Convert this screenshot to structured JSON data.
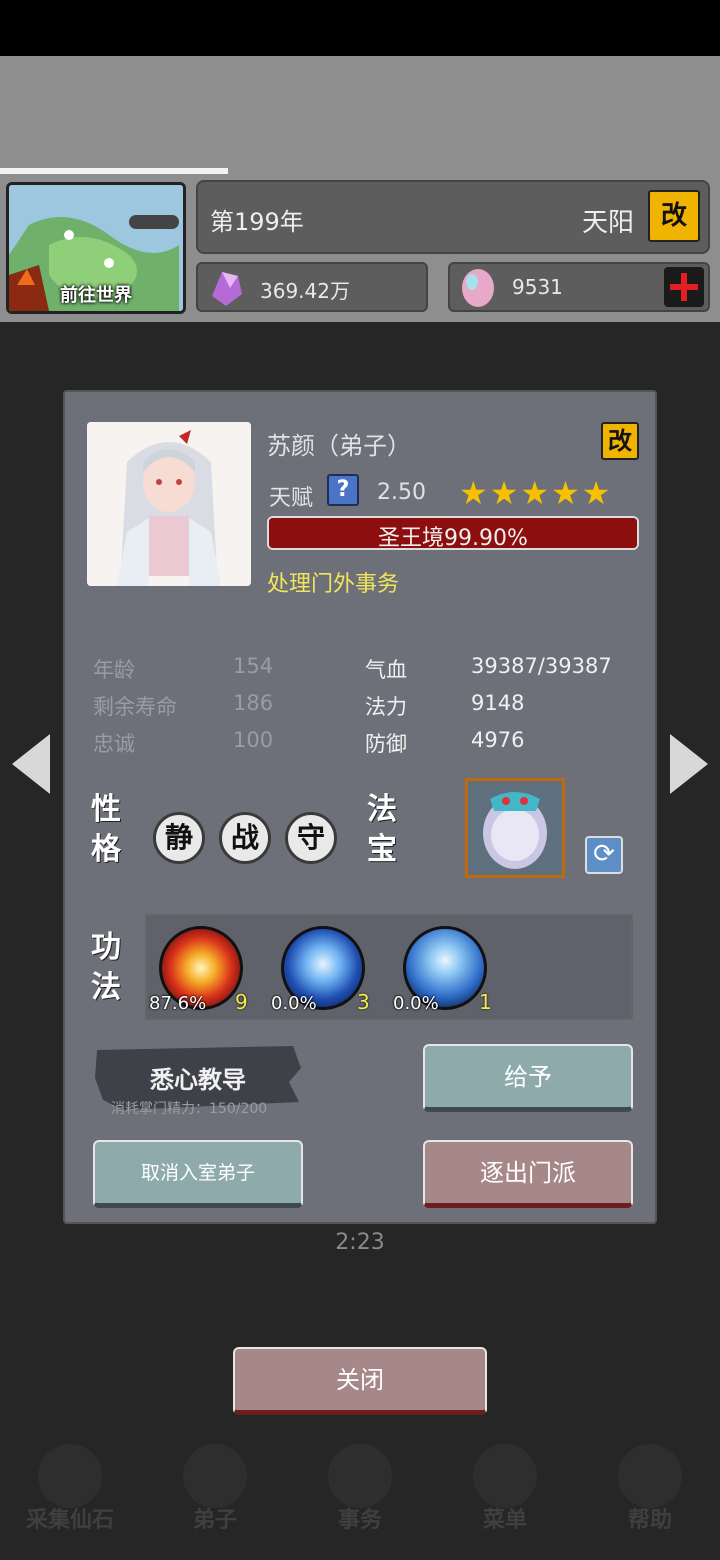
{
  "header": {
    "map_button_label": "前往世界",
    "year": "第199年",
    "sect_name": "天阳",
    "rename_label": "改",
    "spirit_stones": "369.42万",
    "eggs": "9531"
  },
  "disciple": {
    "name": "苏颜（弟子）",
    "rename_label": "改",
    "talent_label": "天赋",
    "talent_help": "?",
    "talent_value": "2.50",
    "stars": "★★★★★",
    "stars_count": 5,
    "realm": "圣王境99.90%",
    "realm_progress": 0.999,
    "task": "处理门外事务",
    "stats_left": [
      {
        "label": "年龄",
        "value": "154"
      },
      {
        "label": "剩余寿命",
        "value": "186"
      },
      {
        "label": "忠诚",
        "value": "100"
      }
    ],
    "stats_right": [
      {
        "label": "气血",
        "value": "39387/39387"
      },
      {
        "label": "法力",
        "value": "9148"
      },
      {
        "label": "防御",
        "value": "4976"
      }
    ],
    "personality_label": "性格",
    "traits": [
      "静",
      "战",
      "守"
    ],
    "artifact_label": "法宝",
    "skills_label": "功法",
    "skills": [
      {
        "pct": "87.6%",
        "level": "9",
        "color": "#e8561a"
      },
      {
        "pct": "0.0%",
        "level": "3",
        "color": "#2f6fd6"
      },
      {
        "pct": "0.0%",
        "level": "1",
        "color": "#3b72c9"
      }
    ]
  },
  "actions": {
    "teach_label": "悉心教导",
    "teach_cost": "消耗掌门精力：150/200",
    "give_label": "给予",
    "cancel_label": "取消入室弟子",
    "expel_label": "逐出门派",
    "close_label": "关闭"
  },
  "background": {
    "timer": "2:23",
    "nav": [
      {
        "label": "采集仙石"
      },
      {
        "label": "弟子"
      },
      {
        "label": "事务"
      },
      {
        "label": "菜单"
      },
      {
        "label": "帮助"
      }
    ]
  },
  "colors": {
    "accent_yellow": "#f0b400",
    "realm_red": "#8c0e0e",
    "task_yellow": "#f1e55a",
    "star": "#f7c000"
  }
}
